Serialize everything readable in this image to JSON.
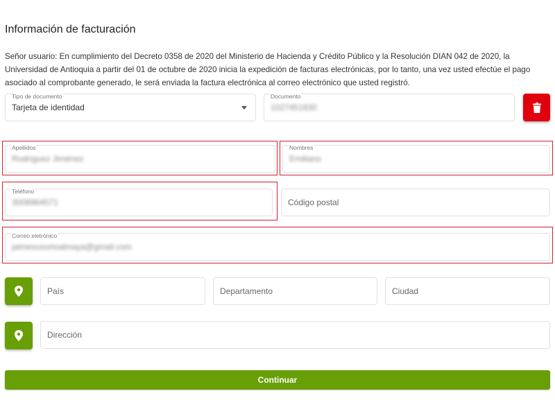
{
  "page": {
    "title": "Información de facturación",
    "notice": "Señor usuario: En cumplimiento del Decreto 0358 de 2020 del Ministerio de Hacienda y Crédito Público y la Resolución DIAN 042 de 2020, la Universidad de Antioquia a partir del 01 de octubre de 2020 inicia la expedición de facturas electrónicas, por lo tanto, una vez usted efectúe el pago asociado al comprobante generado, le será enviada la factura electrónica al correo electrónico que usted registró."
  },
  "form": {
    "document_type": {
      "label": "Tipo de documento",
      "value": "Tarjeta de identidad"
    },
    "document": {
      "label": "Documento",
      "value": "1027451830"
    },
    "surnames": {
      "label": "Apellidos",
      "value": "Rodríguez Jiménez"
    },
    "names": {
      "label": "Nombres",
      "value": "Emiliano"
    },
    "phone": {
      "label": "Teléfono",
      "value": "3008964571"
    },
    "postal_code": {
      "placeholder": "Código postal"
    },
    "email": {
      "label": "Correo eletrónico",
      "value": "jaimesosorioalmaya@gmail.com"
    },
    "country": {
      "placeholder": "País"
    },
    "department": {
      "placeholder": "Departamento"
    },
    "city": {
      "placeholder": "Ciudad"
    },
    "address": {
      "placeholder": "Dirección"
    }
  },
  "buttons": {
    "continue_label": "Continuar"
  },
  "colors": {
    "accent_green": "#689f06",
    "delete_red": "#e0000e",
    "highlight_red": "#d21f2e"
  },
  "icons": {
    "delete": "trash-icon",
    "location": "map-pin-icon"
  }
}
